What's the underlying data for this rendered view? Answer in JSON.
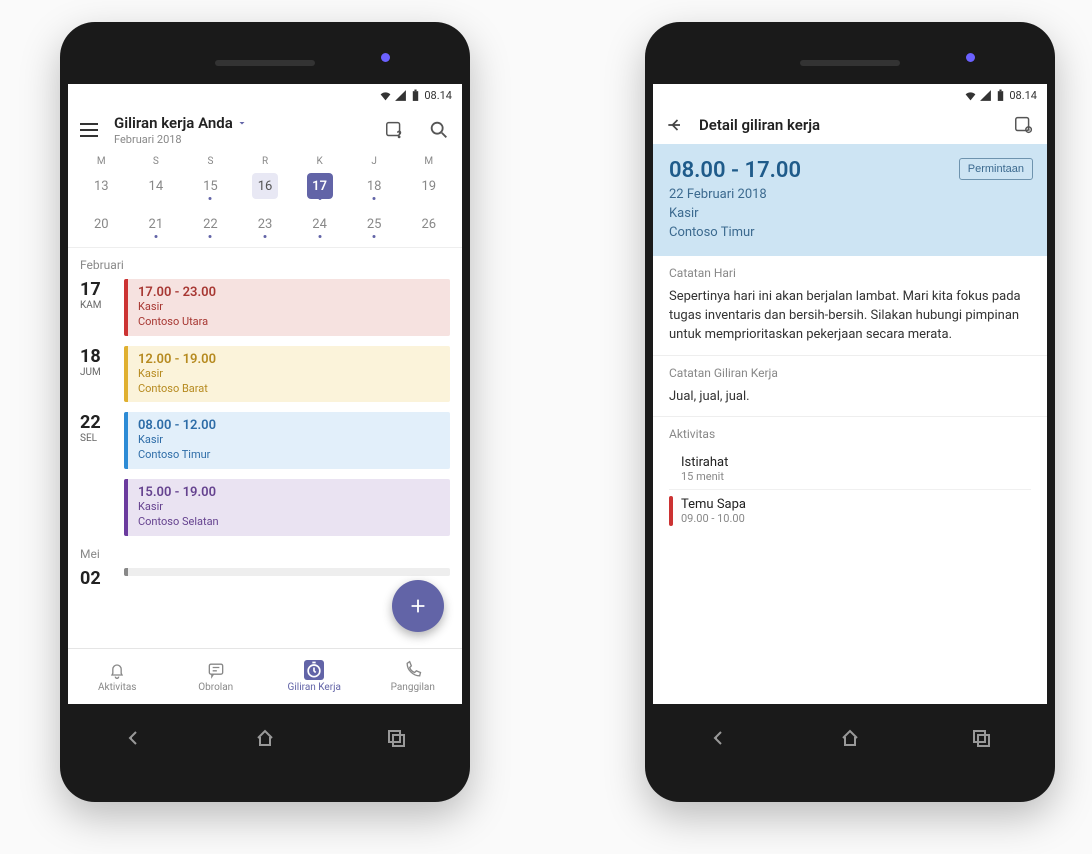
{
  "statusbar": {
    "time": "08.14"
  },
  "left": {
    "header": {
      "title": "Giliran kerja Anda",
      "subtitle": "Februari 2018"
    },
    "weekdays": [
      "M",
      "S",
      "S",
      "R",
      "K",
      "J",
      "M"
    ],
    "cal_row1": [
      {
        "n": "13"
      },
      {
        "n": "14"
      },
      {
        "n": "15",
        "dot": true
      },
      {
        "n": "16",
        "hl": true
      },
      {
        "n": "17",
        "sel": true,
        "dot": true
      },
      {
        "n": "18",
        "dot": true
      },
      {
        "n": "19"
      }
    ],
    "cal_row2": [
      {
        "n": "20"
      },
      {
        "n": "21",
        "dot": true
      },
      {
        "n": "22",
        "dot": true
      },
      {
        "n": "23",
        "dot": true
      },
      {
        "n": "24",
        "dot": true
      },
      {
        "n": "25",
        "dot": true
      },
      {
        "n": "26"
      }
    ],
    "month_label": "Februari",
    "shifts": [
      {
        "day_num": "17",
        "day_name": "KAM",
        "color": "red",
        "time": "17.00 - 23.00",
        "role": "Kasir",
        "loc": "Contoso Utara"
      },
      {
        "day_num": "18",
        "day_name": "JUM",
        "color": "yellow",
        "time": "12.00 - 19.00",
        "role": "Kasir",
        "loc": "Contoso Barat"
      },
      {
        "day_num": "22",
        "day_name": "SEL",
        "color": "blue",
        "time": "08.00 - 12.00",
        "role": "Kasir",
        "loc": "Contoso Timur"
      },
      {
        "day_num": "",
        "day_name": "",
        "color": "purple",
        "time": "15.00 - 19.00",
        "role": "Kasir",
        "loc": "Contoso Selatan"
      }
    ],
    "month_label2": "Mei",
    "partial_day": "02",
    "tabs": {
      "activity": "Aktivitas",
      "chat": "Obrolan",
      "shifts": "Giliran Kerja",
      "calls": "Panggilan"
    }
  },
  "right": {
    "header_title": "Detail giliran kerja",
    "hero": {
      "time": "08.00 - 17.00",
      "date": "22 Februari 2018",
      "role": "Kasir",
      "loc": "Contoso Timur",
      "request_btn": "Permintaan"
    },
    "day_notes_title": "Catatan Hari",
    "day_notes_body": "Sepertinya hari ini akan berjalan lambat. Mari kita fokus pada tugas inventaris dan bersih-bersih. Silakan hubungi pimpinan untuk memprioritaskan pekerjaan secara merata.",
    "shift_notes_title": "Catatan Giliran Kerja",
    "shift_notes_body": "Jual, jual, jual.",
    "activities_title": "Aktivitas",
    "activities": [
      {
        "name": "Istirahat",
        "time": "15 menit",
        "bar": ""
      },
      {
        "name": "Temu Sapa",
        "time": "09.00 - 10.00",
        "bar": "red"
      }
    ]
  }
}
